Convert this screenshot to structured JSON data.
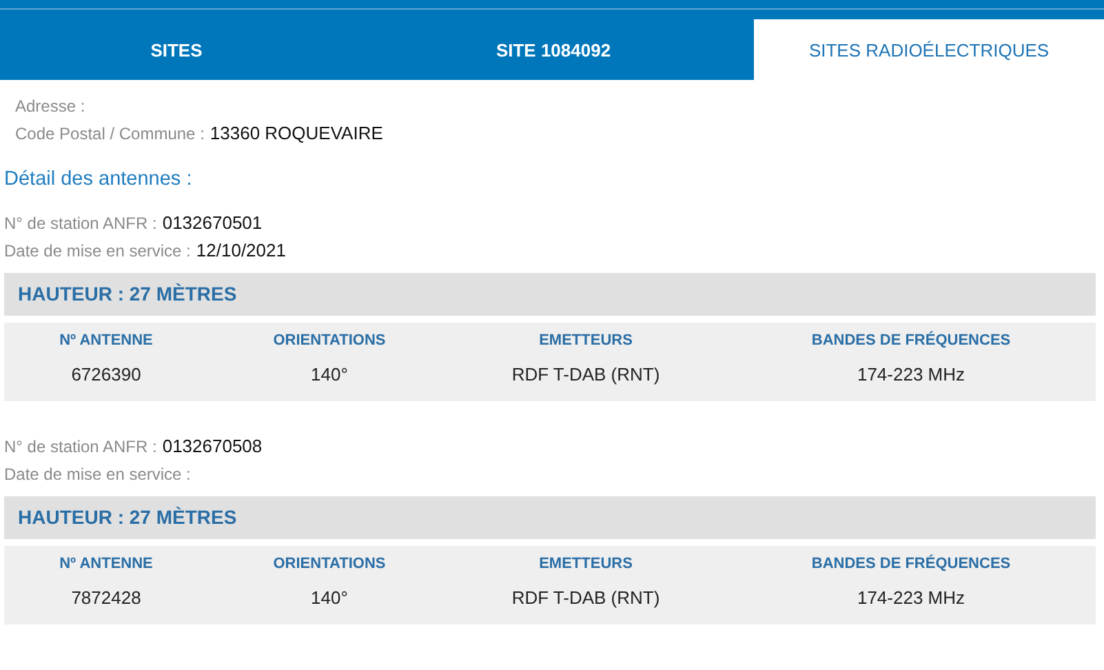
{
  "tabs": [
    {
      "label": "SITES",
      "selected": false
    },
    {
      "label": "SITE 1084092",
      "selected": false
    },
    {
      "label": "SITES RADIOÉLECTRIQUES",
      "selected": true
    }
  ],
  "site_info": [
    {
      "label": "Adresse :"
    },
    {
      "label": "Code Postal / Commune :",
      "value": "13360 ROQUEVAIRE"
    }
  ],
  "section_title": "Détail des antennes :",
  "stations": [
    {
      "station_label": "N° de station ANFR :",
      "station": "0132670501",
      "date_label": "Date de mise en service :",
      "date": "12/10/2021",
      "height": "HAUTEUR : 27 MÈTRES",
      "columns": [
        "Nº ANTENNE",
        "ORIENTATIONS",
        "EMETTEURS",
        "BANDES DE FRÉQUENCES"
      ],
      "rows": [
        [
          "6726390",
          "140°",
          "RDF T-DAB (RNT)",
          "174-223 MHz"
        ]
      ]
    },
    {
      "station_label": "N° de station ANFR :",
      "station": "0132670508",
      "date_label": "Date de mise en service :",
      "height": "HAUTEUR : 27 MÈTRES",
      "columns": [
        "Nº ANTENNE",
        "ORIENTATIONS",
        "EMETTEURS",
        "BANDES DE FRÉQUENCES"
      ],
      "rows": [
        [
          "7872428",
          "140°",
          "RDF T-DAB (RNT)",
          "174-223 MHz"
        ]
      ]
    }
  ]
}
